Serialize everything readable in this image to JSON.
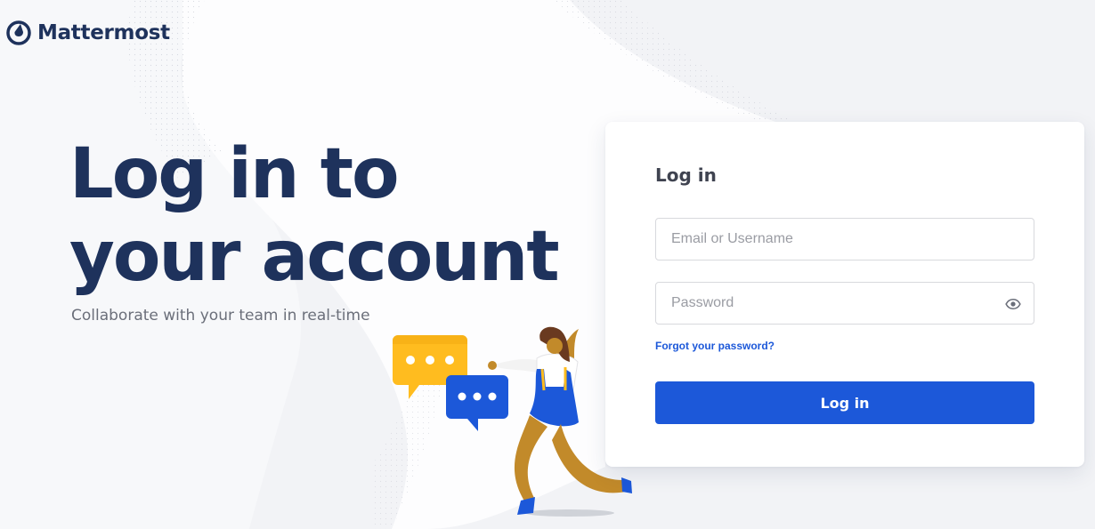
{
  "brand": {
    "name": "Mattermost",
    "icon": "mattermost-logo-icon",
    "color": "#1e325c"
  },
  "hero": {
    "title_line1": "Log in to",
    "title_line2": "your account",
    "subtitle": "Collaborate with your team in real-time"
  },
  "login_form": {
    "title": "Log in",
    "email_placeholder": "Email or Username",
    "email_value": "",
    "password_placeholder": "Password",
    "password_value": "",
    "password_toggle_icon": "eye-icon",
    "forgot_link": "Forgot your password?",
    "submit_label": "Log in"
  },
  "colors": {
    "accent": "#1c58d9",
    "heading": "#1e325c",
    "bubble_yellow": "#ffbc1f",
    "bubble_blue": "#1c58d9"
  }
}
